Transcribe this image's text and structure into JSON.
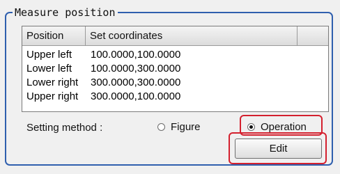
{
  "group": {
    "title": "Measure position"
  },
  "table": {
    "columns": [
      "Position",
      "Set coordinates",
      ""
    ],
    "rows": [
      {
        "position": "Upper left",
        "coords": "100.0000,100.0000"
      },
      {
        "position": "Lower left",
        "coords": "100.0000,300.0000"
      },
      {
        "position": "Lower right",
        "coords": "300.0000,300.0000"
      },
      {
        "position": "Upper right",
        "coords": "300.0000,100.0000"
      }
    ]
  },
  "setting": {
    "label": "Setting method :",
    "options": [
      {
        "label": "Figure",
        "selected": false
      },
      {
        "label": "Operation",
        "selected": true
      }
    ]
  },
  "edit_button": {
    "label": "Edit"
  },
  "colors": {
    "group_border": "#2f5fae",
    "highlight": "#d4202e"
  }
}
